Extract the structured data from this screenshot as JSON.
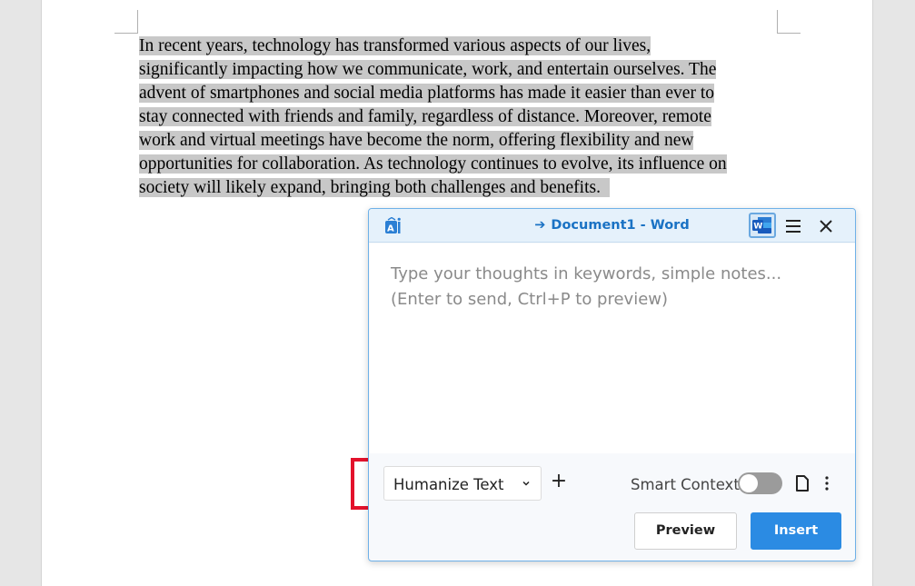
{
  "document": {
    "lines": [
      "In recent years, technology has transformed various aspects of our lives,",
      "significantly impacting how we communicate, work, and entertain ourselves. The",
      "advent of smartphones and social media platforms has made it easier than ever to",
      "stay connected with friends and family, regardless of distance. Moreover, remote",
      "work and virtual meetings have become the norm, offering flexibility and new",
      "opportunities for collaboration. As technology continues to evolve, its influence on",
      "society will likely expand, bringing both challenges and benefits."
    ],
    "selection_color": "#c8c8c8"
  },
  "panel": {
    "header": {
      "arrow": "➔",
      "title": "Document1 - Word",
      "logo_icon": "ai-logo-icon",
      "word_icon": "word-icon",
      "menu_icon": "hamburger-menu-icon",
      "close_icon": "close-icon"
    },
    "prompt": {
      "value": "",
      "placeholder": "Type your thoughts in keywords, simple notes...\n(Enter to send, Ctrl+P to preview)"
    },
    "mode_select": {
      "selected": "Humanize Text"
    },
    "add_label": "+",
    "smart_context": {
      "label": "Smart Context",
      "enabled": false
    },
    "preview_label": "Preview",
    "insert_label": "Insert"
  },
  "colors": {
    "accent": "#2b8be3",
    "title_blue": "#1a72c4",
    "highlight_red": "#e3122c",
    "header_bg": "#e5f1fb"
  }
}
